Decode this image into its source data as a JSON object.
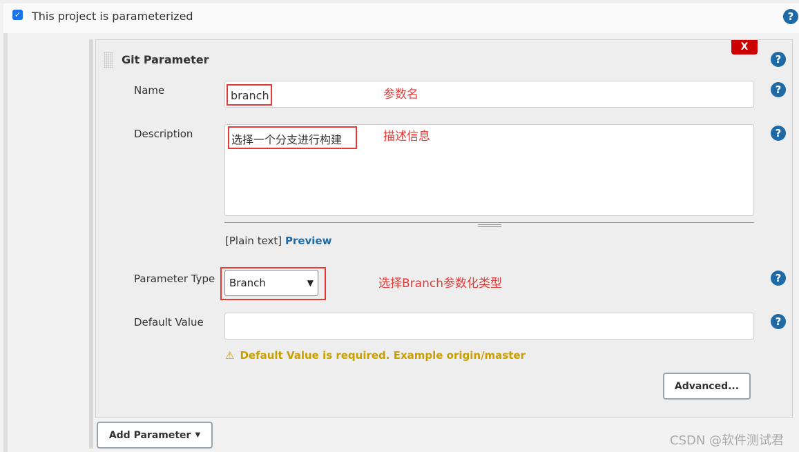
{
  "header": {
    "checkbox_label": "This project is parameterized",
    "checked": true
  },
  "panel": {
    "title": "Git Parameter",
    "delete_label": "X"
  },
  "fields": {
    "name": {
      "label": "Name",
      "value": "branch",
      "annotation": "参数名"
    },
    "description": {
      "label": "Description",
      "value": "选择一个分支进行构建",
      "annotation": "描述信息",
      "plain_text": "[Plain text]",
      "preview": "Preview"
    },
    "parameter_type": {
      "label": "Parameter Type",
      "value": "Branch",
      "annotation": "选择Branch参数化类型"
    },
    "default_value": {
      "label": "Default Value",
      "value": "",
      "warning": "Default Value is required. Example origin/master"
    }
  },
  "buttons": {
    "advanced": "Advanced...",
    "add_parameter": "Add Parameter"
  },
  "help_icon": "?",
  "watermark": "CSDN @软件测试君",
  "colors": {
    "help": "#1f6aa5",
    "delete": "#cc0000",
    "warning": "#c9a000",
    "annotation": "#e53935"
  }
}
